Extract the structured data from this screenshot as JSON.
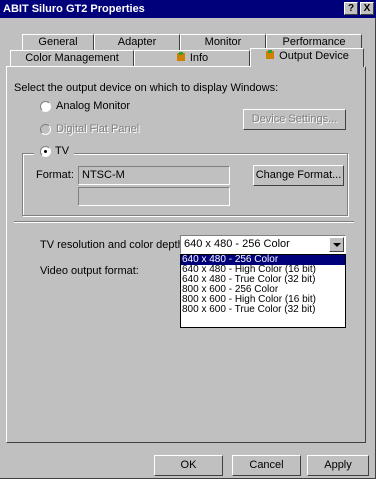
{
  "window": {
    "title": "ABIT Siluro GT2 Properties",
    "help_button": "?",
    "close_button": "X"
  },
  "tabs": {
    "row1": [
      "General",
      "Adapter",
      "Monitor",
      "Performance"
    ],
    "row2": [
      "Color Management",
      "Info",
      "Output Device"
    ]
  },
  "panel": {
    "instruction": "Select the output device on which to display Windows:",
    "analog_monitor": "Analog Monitor",
    "digital_flat_panel": "Digital Flat Panel",
    "device_settings": "Device Settings...",
    "tv": "TV",
    "format_label": "Format:",
    "format_value": "NTSC-M",
    "change_format": "Change Format...",
    "tv_resolution_label": "TV resolution and color depth:",
    "tv_resolution_value": "640 x 480 - 256 Color",
    "video_output_label": "Video output format:",
    "resolution_options": [
      "640 x 480 - 256 Color",
      "640 x 480 - High Color (16 bit)",
      "640 x 480 - True Color (32 bit)",
      "800 x 600 - 256 Color",
      "800 x 600 - High Color (16 bit)",
      "800 x 600 - True Color (32 bit)"
    ]
  },
  "footer": {
    "ok": "OK",
    "cancel": "Cancel",
    "apply": "Apply"
  },
  "colors": {
    "titlebar": "#00007b",
    "face": "#c0c0c0",
    "selection": "#00007b"
  }
}
